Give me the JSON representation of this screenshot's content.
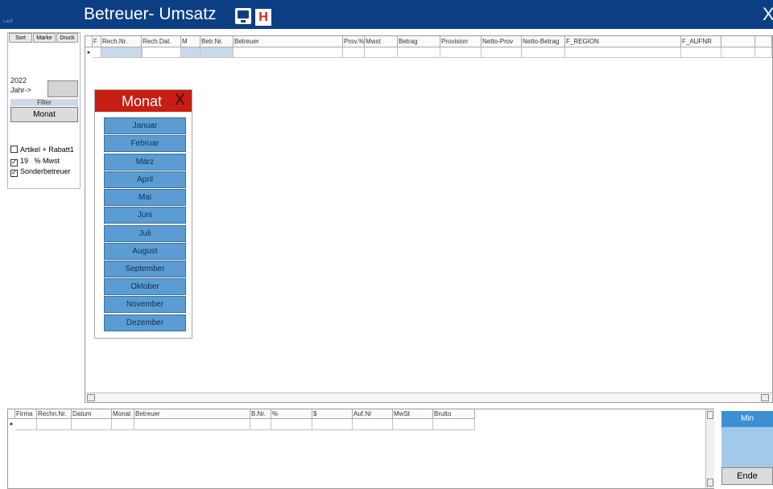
{
  "window": {
    "title": "Betreuer- Umsatz",
    "corner_label": "Lauf",
    "h_button": "H",
    "close": "X"
  },
  "left_panel": {
    "tabs": [
      "Sort",
      "Marke",
      "Druck"
    ],
    "year": "2022",
    "year_label": "Jahr->",
    "filter_label": "Filter",
    "monat_button": "Monat",
    "checkboxes": [
      {
        "label": "Artikel + Rabatt1",
        "checked": false
      },
      {
        "label": "19   % Mwst",
        "checked": true
      },
      {
        "label": "Sonderbetreuer",
        "checked": true
      }
    ]
  },
  "main_grid": {
    "columns": [
      "F",
      "Rech.Nr.",
      "Rech.Dat.",
      "M",
      "Betr.Nr.",
      "Betreuer",
      "Prov.%",
      "Mwst",
      "Betrag",
      "Provision",
      "Netto-Prov",
      "Netto-Betrag",
      "F_REGION",
      "F_AUFNR",
      "",
      ""
    ],
    "row_indicator": "▸"
  },
  "month_popup": {
    "title": "Monat",
    "close": "X",
    "months": [
      "Januar",
      "Februar",
      "März",
      "April",
      "Mai",
      "Juni",
      "Juli",
      "August",
      "September",
      "Oktober",
      "November",
      "Dezember"
    ]
  },
  "bottom_grid": {
    "columns": [
      "Firma",
      "Rechn.Nr.",
      "Datum",
      "Monat",
      "Betreuer",
      "B.Nr.",
      "%",
      "$",
      "Auf.Nr",
      "MwSt",
      "Brutto"
    ],
    "row_indicator": "▸"
  },
  "right_buttons": {
    "min": "Min",
    "ende": "Ende"
  },
  "colors": {
    "title_bar": "#0c3e84",
    "popup_header": "#c81d12",
    "month_button": "#5b9dd2",
    "min_button": "#3b8fd3"
  }
}
